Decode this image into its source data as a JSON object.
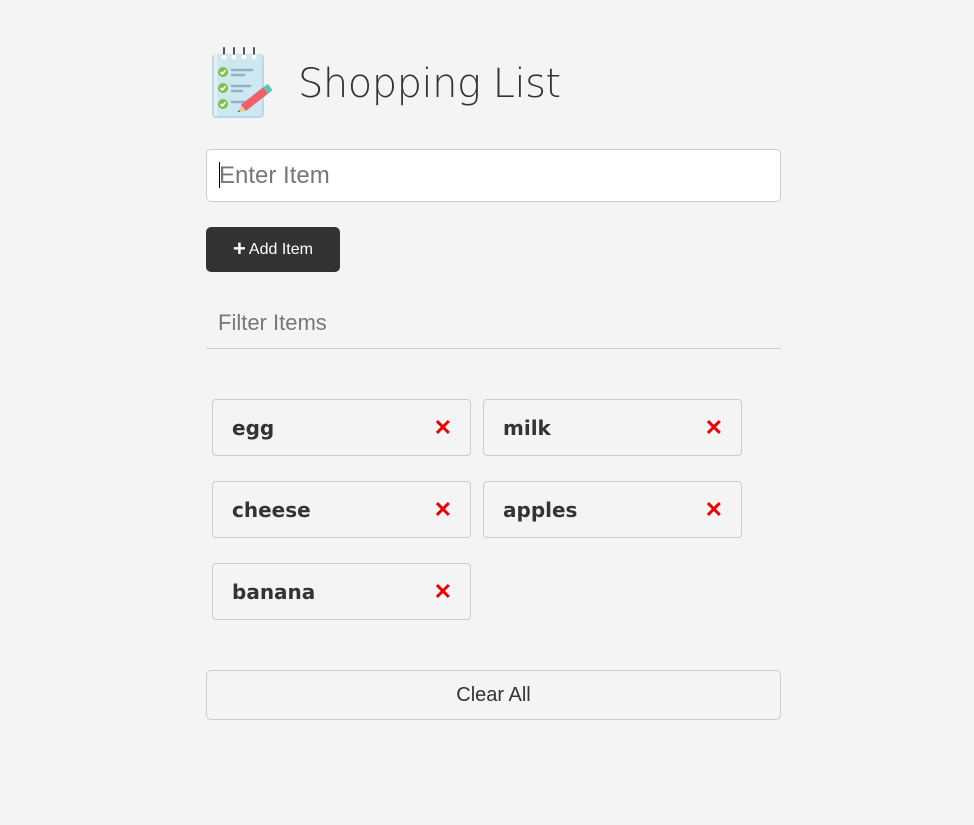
{
  "header": {
    "title": "Shopping List",
    "logo_icon": "notepad-checklist-icon"
  },
  "form": {
    "item_input": {
      "value": "",
      "placeholder": "Enter Item"
    },
    "add_button": {
      "icon": "plus-icon",
      "label": "Add Item"
    }
  },
  "filter": {
    "value": "",
    "placeholder": "Filter Items"
  },
  "items": [
    {
      "name": "egg",
      "remove_icon": "close-icon",
      "remove_color": "#e00000"
    },
    {
      "name": "milk",
      "remove_icon": "close-icon",
      "remove_color": "#e00000"
    },
    {
      "name": "cheese",
      "remove_icon": "close-icon",
      "remove_color": "#e00000"
    },
    {
      "name": "apples",
      "remove_icon": "close-icon",
      "remove_color": "#e00000"
    },
    {
      "name": "banana",
      "remove_icon": "close-icon",
      "remove_color": "#e00000"
    }
  ],
  "clear_button": {
    "label": "Clear All"
  },
  "colors": {
    "background": "#f4f4f4",
    "button_dark": "#333333",
    "remove": "#e00000"
  }
}
